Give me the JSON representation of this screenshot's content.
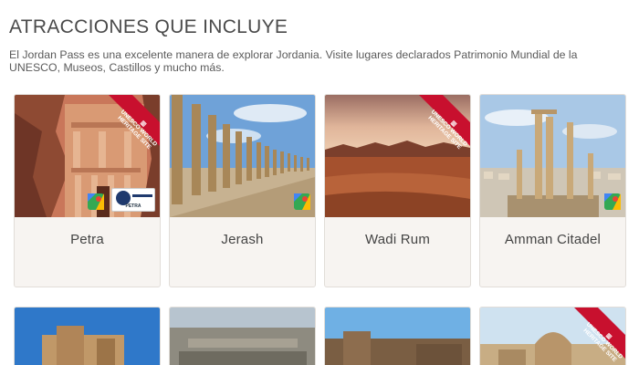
{
  "section": {
    "title": "ATRACCIONES QUE INCLUYE",
    "intro": "El Jordan Pass es una excelente manera de explorar Jordania. Visite lugares declarados Patrimonio Mundial de la UNESCO, Museos, Castillos y mucho más."
  },
  "ribbon": {
    "line1": "UNESCO WORLD",
    "line2": "HERITAGE SITE",
    "color": "#c8102e"
  },
  "badge": {
    "petra_logo_text": "PETRA"
  },
  "attractions": [
    {
      "name": "Petra"
    },
    {
      "name": "Jerash"
    },
    {
      "name": "Wadi Rum"
    },
    {
      "name": "Amman Citadel"
    }
  ]
}
